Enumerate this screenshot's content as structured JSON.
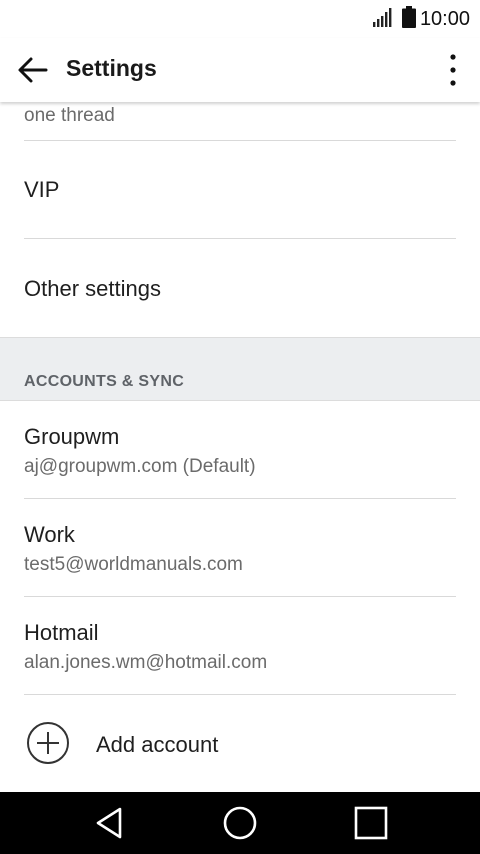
{
  "status_bar": {
    "time": "10:00",
    "icons": [
      "signal-icon",
      "battery-icon"
    ]
  },
  "app_bar": {
    "title": "Settings",
    "icons": [
      "back-arrow-icon",
      "more-vert-icon"
    ]
  },
  "settings": {
    "partial_row_sub": "one thread",
    "vip_label": "VIP",
    "other_settings_label": "Other settings"
  },
  "accounts_section": {
    "header": "ACCOUNTS & SYNC",
    "accounts": [
      {
        "name": "Groupwm",
        "email": "aj@groupwm.com (Default)"
      },
      {
        "name": "Work",
        "email": "test5@worldmanuals.com"
      },
      {
        "name": "Hotmail",
        "email": "alan.jones.wm@hotmail.com"
      }
    ],
    "add_account_label": "Add account",
    "add_account_icon": "add-circle-icon"
  },
  "nav_bar": {
    "icons": [
      "back-triangle-icon",
      "home-circle-icon",
      "recents-square-icon"
    ]
  }
}
